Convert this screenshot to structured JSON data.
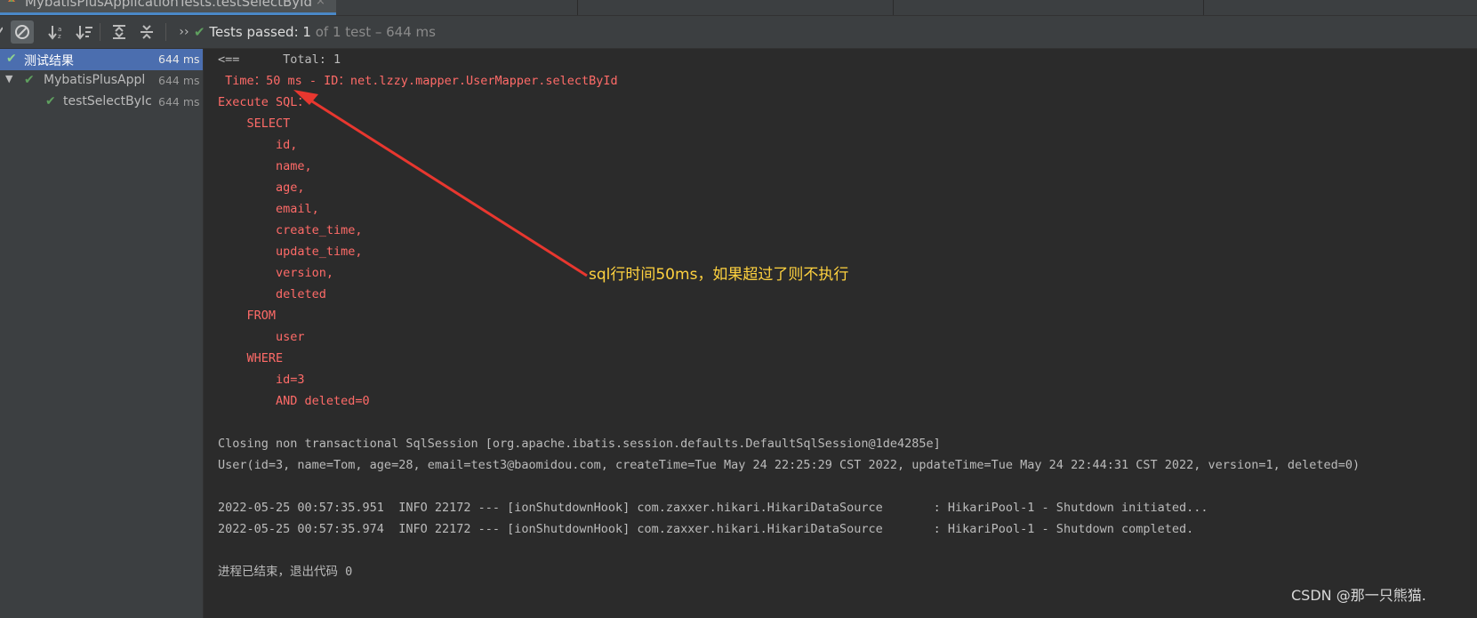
{
  "tab": {
    "title": "MybatisPlusApplicationTests.testSelectById",
    "close": "×"
  },
  "toolbar": {
    "more": "››",
    "status_check": "✔",
    "status_bold": "Tests passed:",
    "status_count": "1",
    "status_rest": "of 1 test – 644 ms"
  },
  "tree": {
    "items": [
      {
        "label": "测试结果",
        "time": "644 ms"
      },
      {
        "label": "MybatisPlusAppl",
        "time": "644 ms"
      },
      {
        "label": "testSelectByIc",
        "time": "644 ms"
      }
    ]
  },
  "console": {
    "lines": [
      "<==      Total: 1",
      " Time：50 ms - ID：net.lzzy.mapper.UserMapper.selectById",
      "Execute SQL：",
      "    SELECT",
      "        id,",
      "        name,",
      "        age,",
      "        email,",
      "        create_time,",
      "        update_time,",
      "        version,",
      "        deleted",
      "    FROM",
      "        user",
      "    WHERE",
      "        id=3",
      "        AND deleted=0",
      "",
      "Closing non transactional SqlSession [org.apache.ibatis.session.defaults.DefaultSqlSession@1de4285e]",
      "User(id=3, name=Tom, age=28, email=test3@baomidou.com, createTime=Tue May 24 22:25:29 CST 2022, updateTime=Tue May 24 22:44:31 CST 2022, version=1, deleted=0)",
      "",
      "2022-05-25 00:57:35.951  INFO 22172 --- [ionShutdownHook] com.zaxxer.hikari.HikariDataSource       : HikariPool-1 - Shutdown initiated...",
      "2022-05-25 00:57:35.974  INFO 22172 --- [ionShutdownHook] com.zaxxer.hikari.HikariDataSource       : HikariPool-1 - Shutdown completed.",
      "",
      "进程已结束，退出代码 0"
    ]
  },
  "annotation": {
    "text": "sql行时间50ms，如果超过了则不执行",
    "color": "#ffd23f"
  },
  "arrow_color": "#e8372f",
  "watermark": "CSDN @那一只熊猫."
}
